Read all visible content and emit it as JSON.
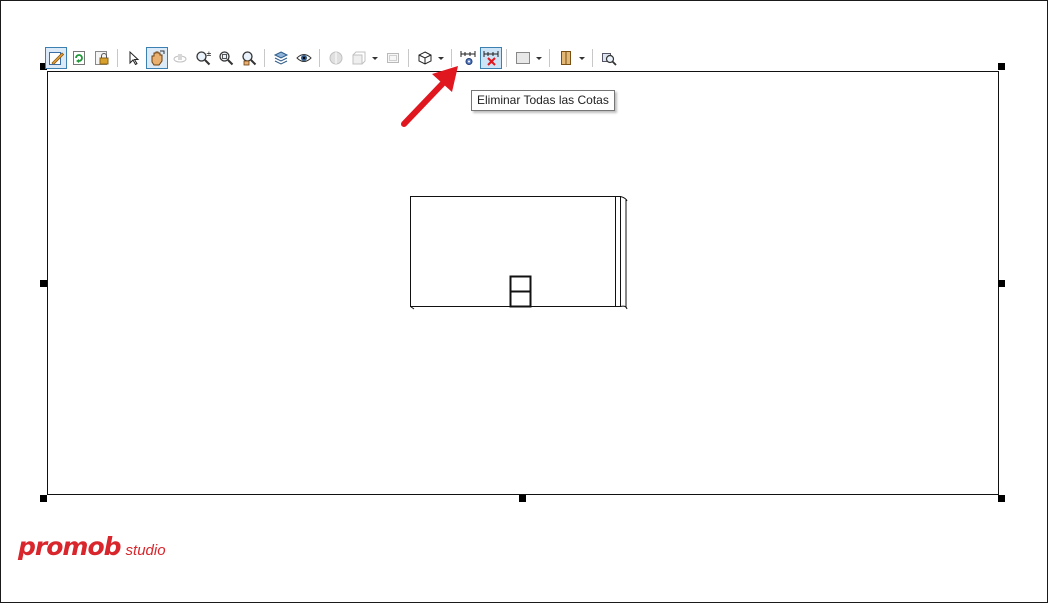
{
  "toolbar": {
    "buttons": [
      {
        "name": "edit-view-button",
        "icon": "pencil-icon",
        "state": "active"
      },
      {
        "name": "refresh-button",
        "icon": "refresh-icon"
      },
      {
        "name": "lock-button",
        "icon": "lock-icon"
      },
      {
        "name": "select-button",
        "icon": "cursor-icon"
      },
      {
        "name": "pan-button",
        "icon": "hand-icon",
        "state": "active"
      },
      {
        "name": "orbit-button",
        "icon": "orbit-icon",
        "state": "disabled"
      },
      {
        "name": "zoom-button",
        "icon": "zoom-icon"
      },
      {
        "name": "zoom-window-button",
        "icon": "zoom-window-icon"
      },
      {
        "name": "zoom-fit-button",
        "icon": "zoom-fit-icon"
      },
      {
        "name": "layers-button",
        "icon": "layers-icon"
      },
      {
        "name": "visibility-button",
        "icon": "eye-icon"
      },
      {
        "name": "render-button",
        "icon": "render-icon",
        "state": "disabled"
      },
      {
        "name": "view-mode-button",
        "icon": "cube-wire-icon",
        "state": "disabled"
      },
      {
        "name": "frame-button",
        "icon": "frame-icon",
        "state": "disabled"
      },
      {
        "name": "cube-view-button",
        "icon": "cube-icon"
      },
      {
        "name": "auto-dimension-button",
        "icon": "dimension-gear-icon"
      },
      {
        "name": "delete-all-dimensions-button",
        "icon": "dimension-delete-icon",
        "state": "pressed"
      },
      {
        "name": "color-button",
        "icon": "color-swatch-icon"
      },
      {
        "name": "door-button",
        "icon": "door-icon"
      },
      {
        "name": "inspect-button",
        "icon": "inspect-icon"
      }
    ],
    "tooltip": "Eliminar Todas las Cotas"
  },
  "annotation": {
    "type": "arrow",
    "color": "#e0171f",
    "points_to": "delete-all-dimensions-button"
  },
  "drawing": {
    "element": "furniture-front-view",
    "panel": "handle"
  },
  "logo": {
    "main": "promob",
    "sub": "studio",
    "color": "#d8262c"
  },
  "colors": {
    "accent": "#3c7fb1",
    "arrow": "#e0171f"
  }
}
